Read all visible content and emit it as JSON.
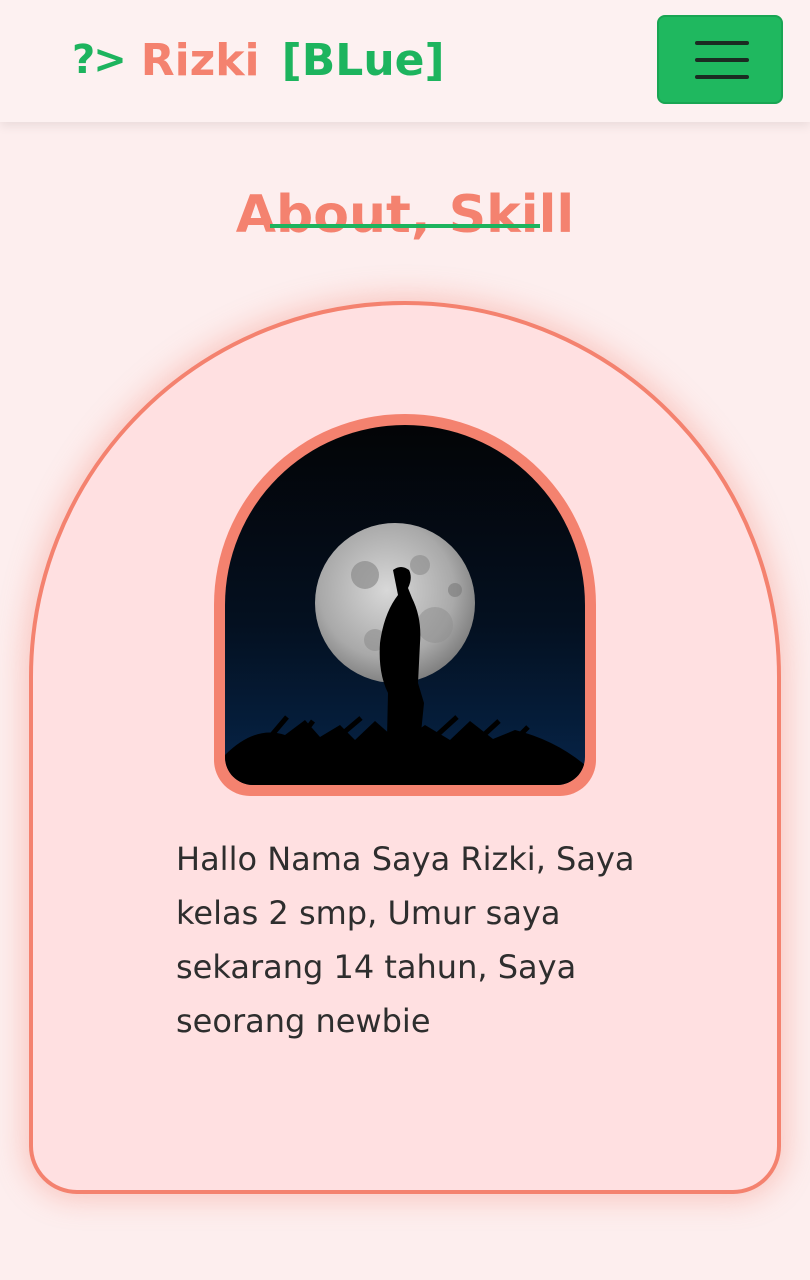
{
  "navbar": {
    "brand_prompt": "?>",
    "brand_name": "Rizki",
    "brand_tag": "[BLue]",
    "menu_icon": "hamburger-icon"
  },
  "about": {
    "title": "About, Skill",
    "photo_alt": "Silhouette of a person standing in front of a full moon",
    "text": "Hallo Nama Saya Rizki, Saya kelas 2 smp, Umur saya sekarang 14 tahun, Saya seorang newbie"
  },
  "colors": {
    "accent_green": "#1db45e",
    "accent_salmon": "#f4826f",
    "background": "#fdeeee",
    "card_background": "#ffe0e1"
  }
}
